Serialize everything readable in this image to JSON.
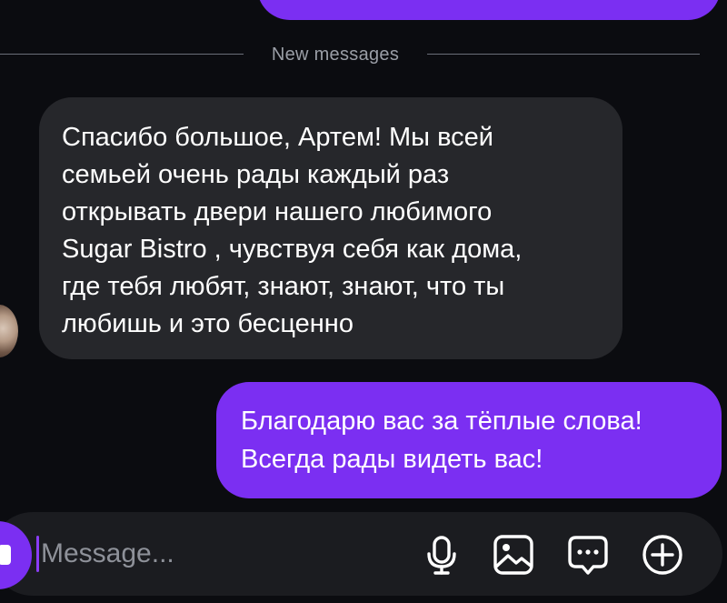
{
  "divider": {
    "label": "New messages"
  },
  "incoming_message": {
    "lines": [
      "Спасибо большое, Артем! Мы всей",
      "семьей очень рады каждый раз",
      "открывать двери нашего любимого",
      "Sugar Bistro , чувствуя себя как дома,",
      "где тебя любят, знают, знают, что ты",
      "любишь и это бесценно"
    ]
  },
  "outgoing_message": {
    "lines": [
      "Благодарю вас за тёплые слова!",
      "Всегда рады видеть вас!"
    ]
  },
  "composer": {
    "placeholder": "Message...",
    "value": "",
    "icons": [
      "camera-icon",
      "microphone-icon",
      "gallery-icon",
      "sticker-icon",
      "plus-icon"
    ]
  },
  "colors": {
    "background": "#0b0c10",
    "incoming_bubble": "#26272b",
    "outgoing_bubble": "#7b2ff2",
    "composer_bar": "#1b1c20",
    "divider_text": "#9a9ea6"
  }
}
